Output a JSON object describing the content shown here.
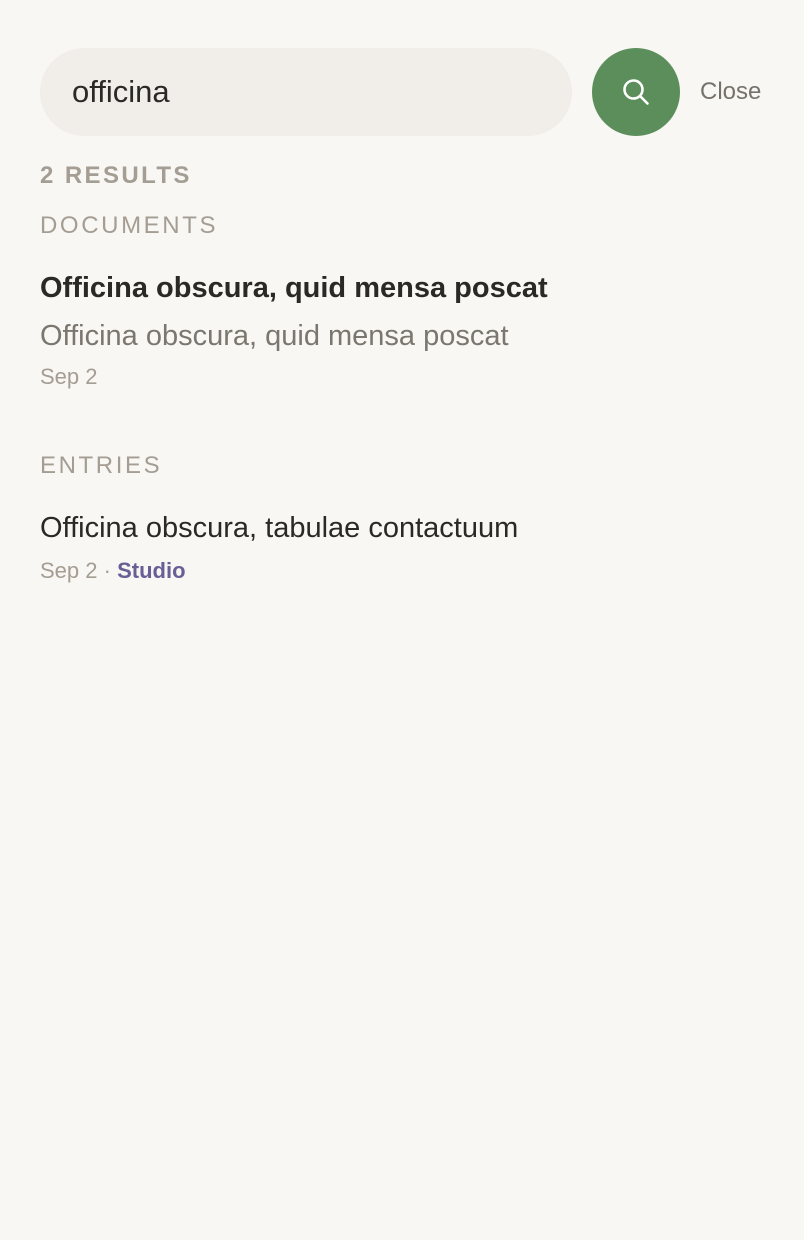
{
  "search": {
    "value": "officina",
    "close_label": "Close",
    "button_icon": "search-icon"
  },
  "results": {
    "count_label": "2 RESULTS"
  },
  "documents": {
    "heading": "DOCUMENTS",
    "items": [
      {
        "title": "Officina obscura, quid mensa poscat",
        "snippet": "Officina obscura, quid mensa poscat",
        "date": "Sep 2"
      }
    ]
  },
  "entries": {
    "heading": "ENTRIES",
    "items": [
      {
        "title": "Officina obscura, tabulae contactuum",
        "date": "Sep 2",
        "separator": "·",
        "tag": "Studio"
      }
    ]
  },
  "colors": {
    "background": "#f9f7f3",
    "search_field": "#f1eeea",
    "accent_green": "#5b8e5a",
    "tag_purple": "#6a5e96",
    "muted_text": "#a49d93"
  }
}
